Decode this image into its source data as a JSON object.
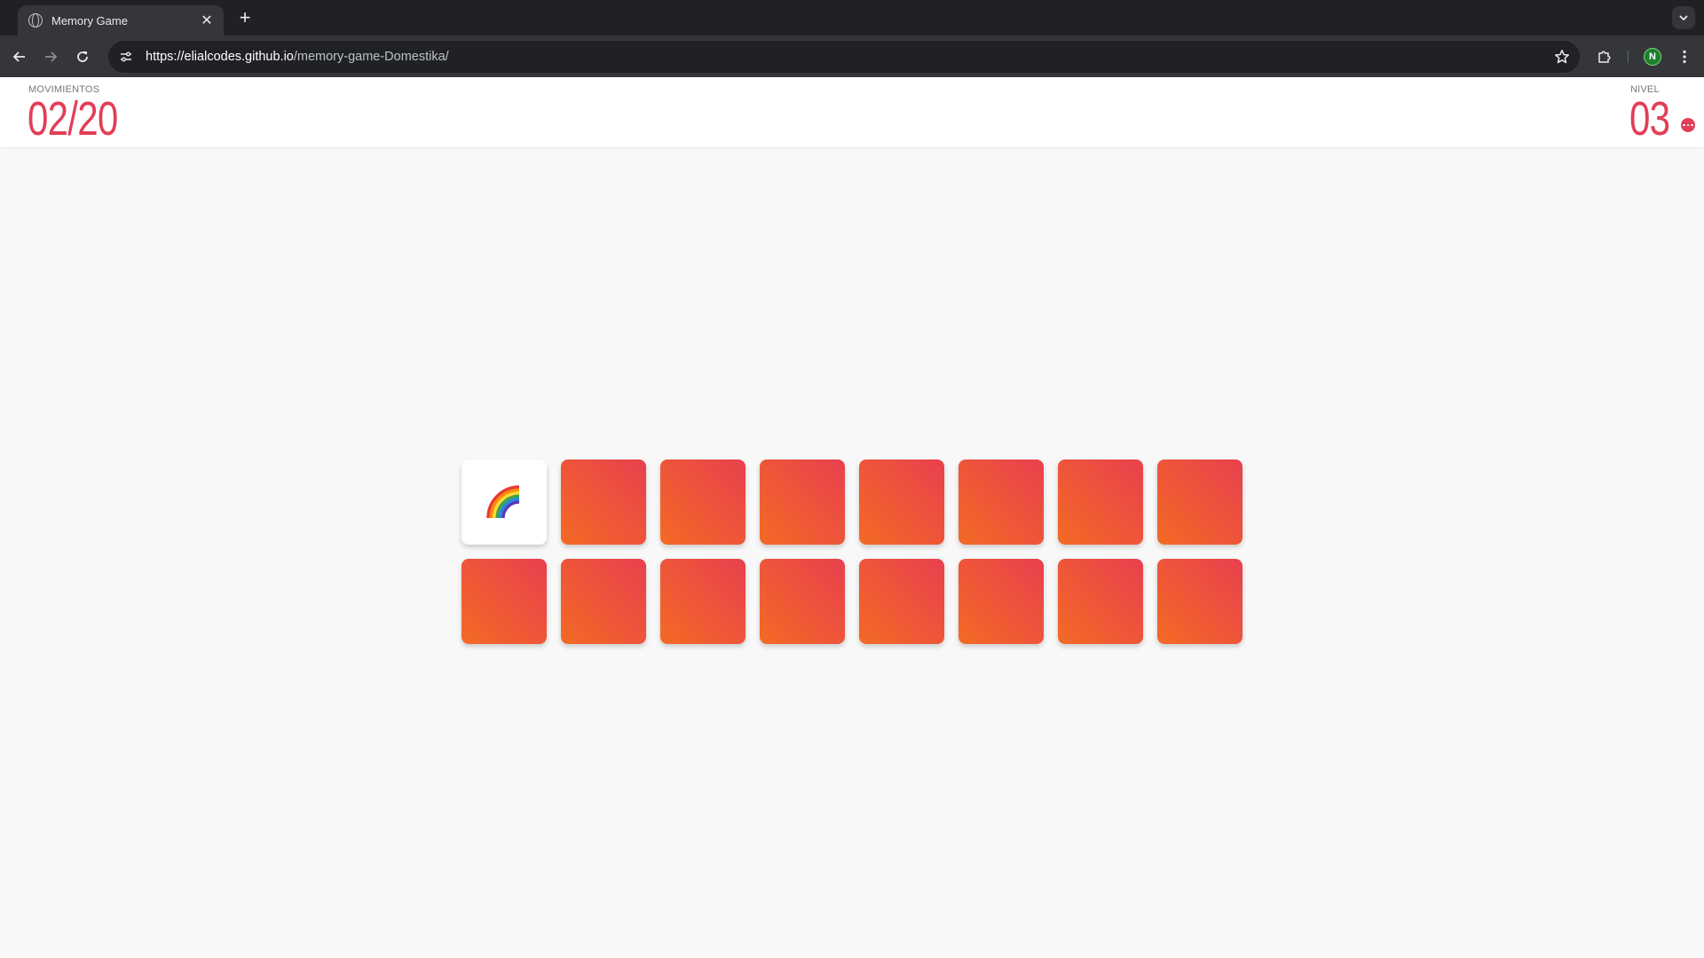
{
  "browser": {
    "tab_title": "Memory Game",
    "tab_close": "✕",
    "new_tab": "+",
    "url_host": "https://elialcodes.github.io",
    "url_path": "/memory-game-Domestika/",
    "profile_initial": "N"
  },
  "game": {
    "moves_label": "MOVIMIENTOS",
    "moves_value": "02/20",
    "level_label": "NIVEL",
    "level_value": "03",
    "accent_color": "#e23e57",
    "card_back_gradient": [
      "#f36a24",
      "#e8404f"
    ],
    "cards": [
      {
        "state": "revealed",
        "icon": "rainbow-icon"
      },
      {
        "state": "hidden"
      },
      {
        "state": "hidden"
      },
      {
        "state": "hidden"
      },
      {
        "state": "hidden"
      },
      {
        "state": "hidden"
      },
      {
        "state": "hidden"
      },
      {
        "state": "hidden"
      },
      {
        "state": "hidden"
      },
      {
        "state": "hidden"
      },
      {
        "state": "hidden"
      },
      {
        "state": "hidden"
      },
      {
        "state": "hidden"
      },
      {
        "state": "hidden"
      },
      {
        "state": "hidden"
      },
      {
        "state": "hidden"
      }
    ]
  }
}
